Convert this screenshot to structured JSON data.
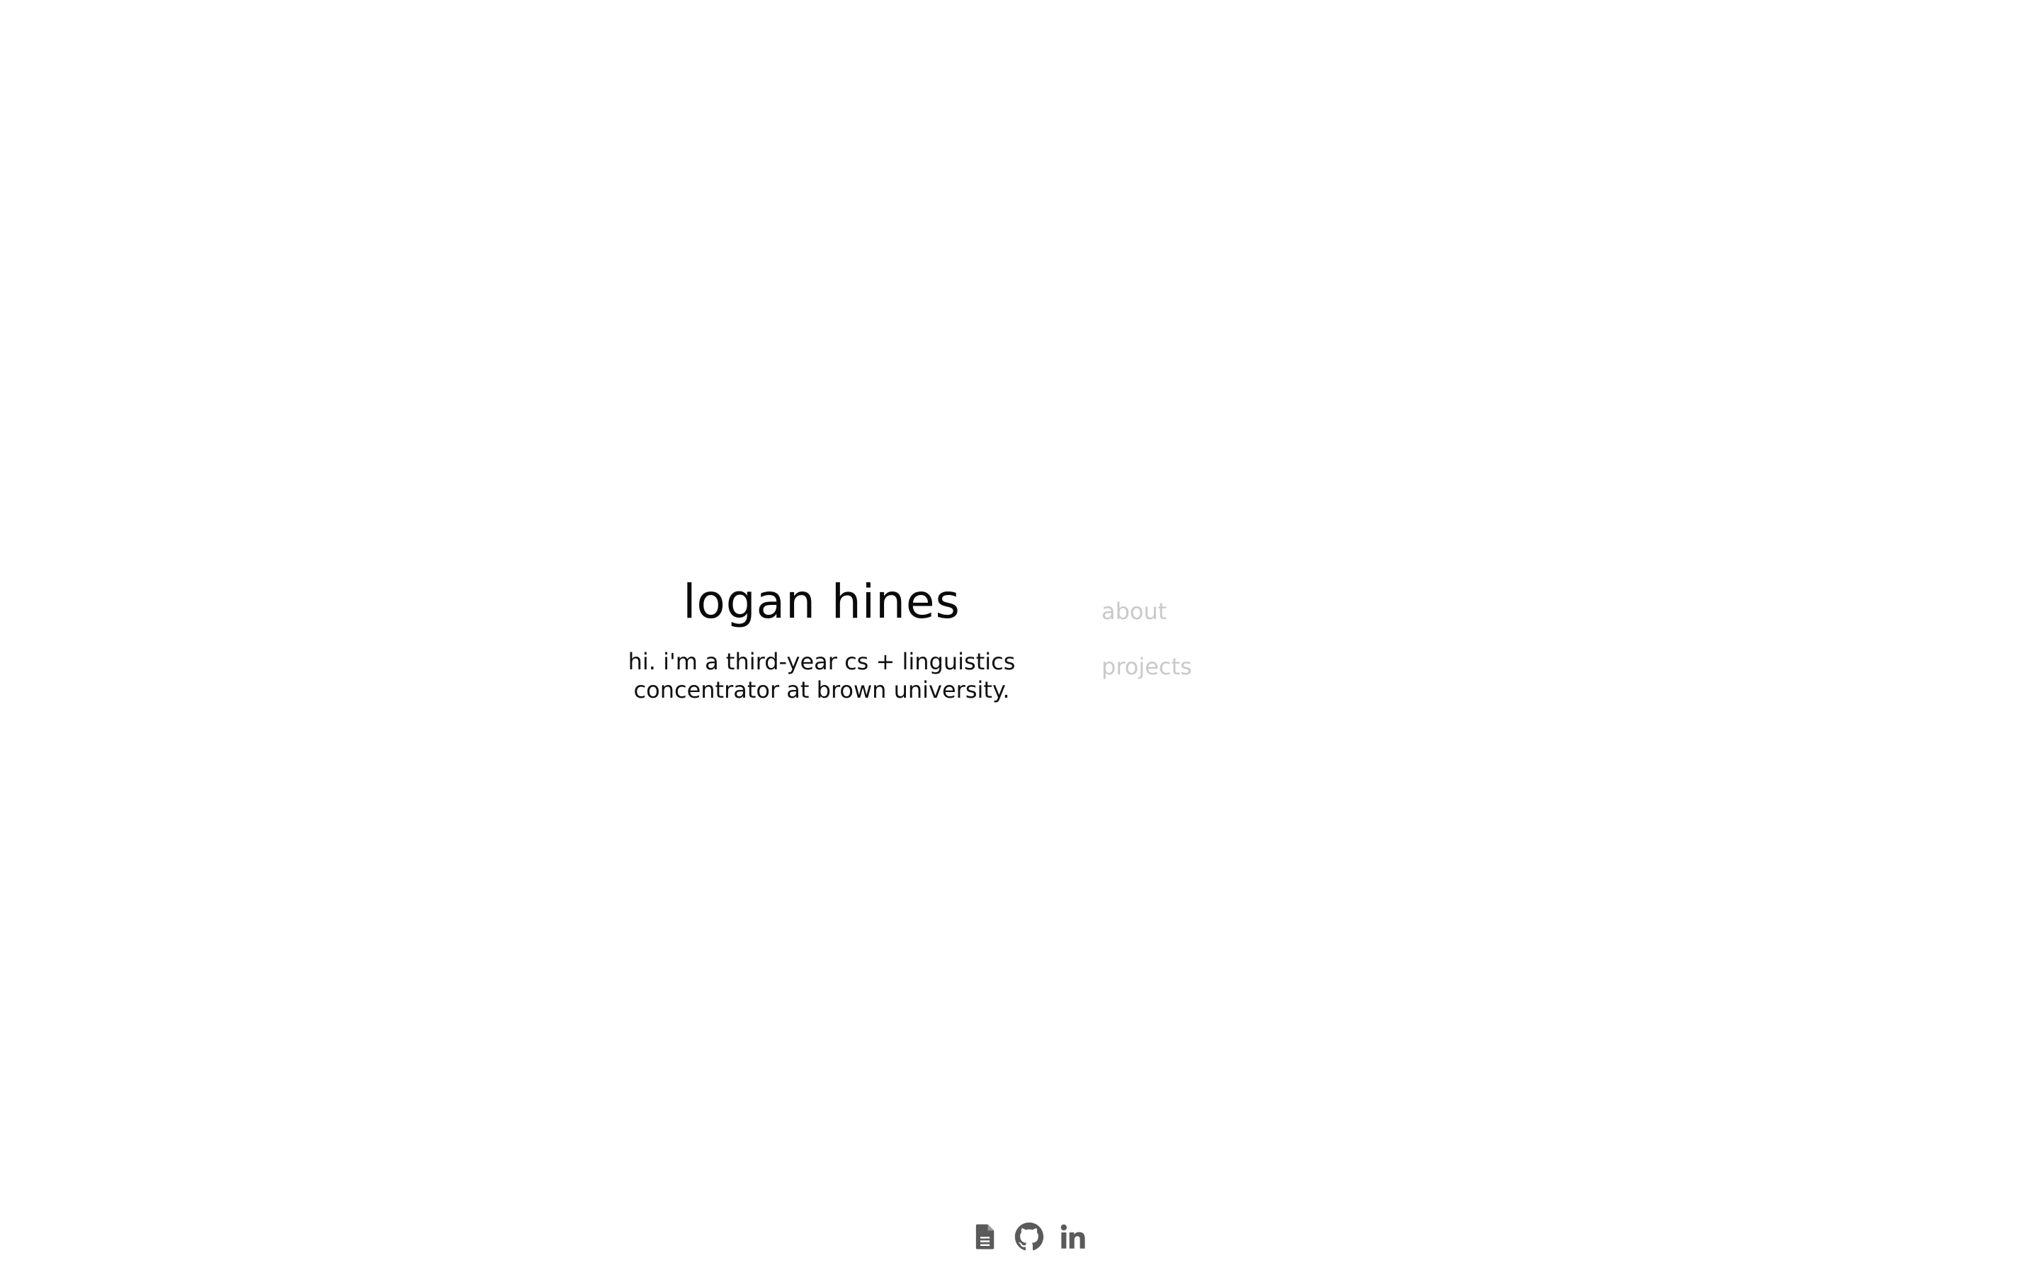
{
  "hero": {
    "name": "logan hines",
    "intro_line1": "hi. i'm a third-year cs + linguistics",
    "intro_line2": "concentrator at brown university."
  },
  "nav": {
    "items": [
      {
        "label": "about"
      },
      {
        "label": "projects"
      }
    ]
  },
  "social": {
    "icons": [
      "document-icon",
      "github-icon",
      "linkedin-icon"
    ],
    "icon_color": "#5a5a5a"
  },
  "colors": {
    "text": "#0a0a0a",
    "nav_text": "#c9c9c9",
    "background": "#ffffff"
  }
}
